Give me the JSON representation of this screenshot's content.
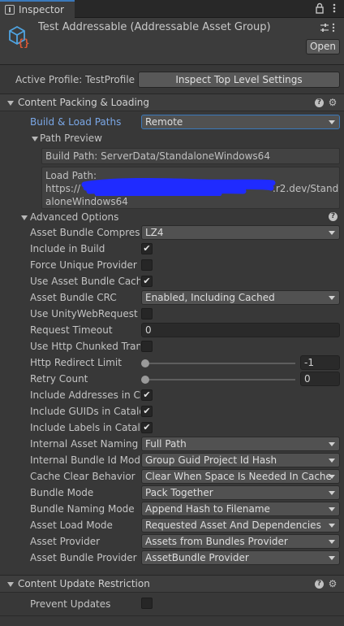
{
  "tab": {
    "title": "Inspector"
  },
  "header": {
    "title": "Test Addressable (Addressable Asset Group)",
    "open_label": "Open"
  },
  "profile": {
    "label": "Active Profile: TestProfile",
    "button": "Inspect Top Level Settings"
  },
  "content": {
    "title": "Content Packing & Loading",
    "build_load_label": "Build & Load Paths",
    "build_load_value": "Remote",
    "path_preview_title": "Path Preview",
    "build_path": "Build Path: ServerData/StandaloneWindows64",
    "load_path_label": "Load Path:",
    "load_path_line1_start": "https://",
    "load_path_line1_end": ".r2.dev/Stand",
    "load_path_line2": "aloneWindows64",
    "advanced_title": "Advanced Options",
    "rows": {
      "compression_label": "Asset Bundle Compressi",
      "compression_value": "LZ4",
      "include_build_label": "Include in Build",
      "force_unique_label": "Force Unique Provider",
      "use_cache_label": "Use Asset Bundle Cache",
      "crc_label": "Asset Bundle CRC",
      "crc_value": "Enabled, Including Cached",
      "uwr_label": "Use UnityWebRequest fo",
      "timeout_label": "Request Timeout",
      "timeout_value": "0",
      "chunked_label": "Use Http Chunked Trans",
      "redirect_label": "Http Redirect Limit",
      "redirect_value": "-1",
      "retry_label": "Retry Count",
      "retry_value": "0",
      "incl_addr_label": "Include Addresses in Cat",
      "incl_guids_label": "Include GUIDs in Catalog",
      "incl_labels_label": "Include Labels in Catalo",
      "naming_label": "Internal Asset Naming M",
      "naming_value": "Full Path",
      "bundle_id_label": "Internal Bundle Id Mode",
      "bundle_id_value": "Group Guid Project Id Hash",
      "cache_clear_label": "Cache Clear Behavior",
      "cache_clear_value": "Clear When Space Is Needed In Cache",
      "bundle_mode_label": "Bundle Mode",
      "bundle_mode_value": "Pack Together",
      "bundle_naming_label": "Bundle Naming Mode",
      "bundle_naming_value": "Append Hash to Filename",
      "load_mode_label": "Asset Load Mode",
      "load_mode_value": "Requested Asset And Dependencies",
      "provider_label": "Asset Provider",
      "provider_value": "Assets from Bundles Provider",
      "bundle_provider_label": "Asset Bundle Provider",
      "bundle_provider_value": "AssetBundle Provider"
    }
  },
  "update": {
    "title": "Content Update Restriction",
    "prevent_label": "Prevent Updates"
  },
  "checks": {
    "include_build": true,
    "force_unique": false,
    "use_cache": true,
    "uwr": false,
    "chunked": false,
    "incl_addr": true,
    "incl_guids": true,
    "incl_labels": true,
    "prevent": false
  },
  "sliders": {
    "redirect": 0.0,
    "retry": 0.0
  },
  "colors": {
    "accent": "#3a79bb",
    "link_label": "#7aa7e6",
    "redaction": "#1f2bff"
  }
}
